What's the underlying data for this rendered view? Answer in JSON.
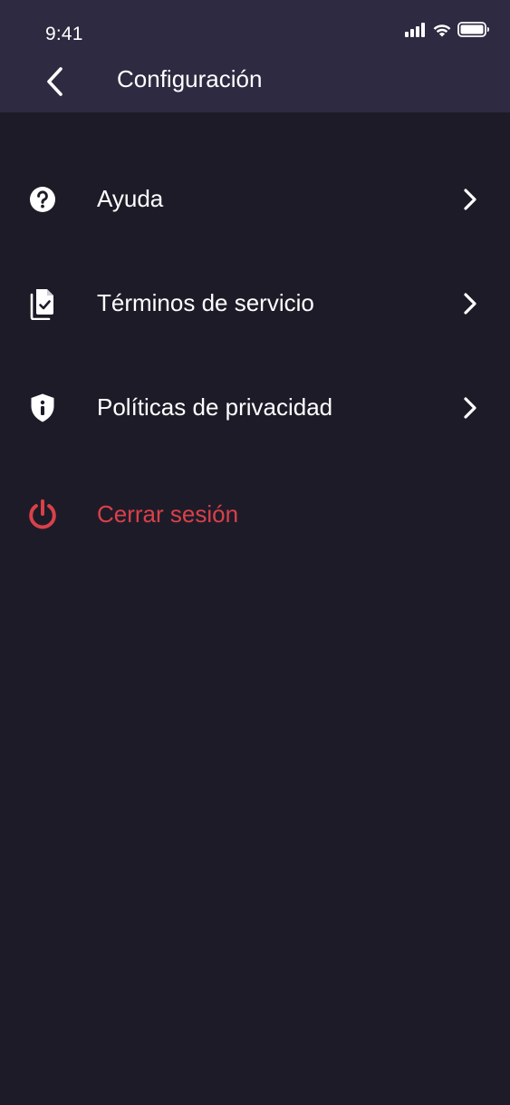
{
  "status_bar": {
    "time": "9:41"
  },
  "header": {
    "title": "Configuración"
  },
  "menu": {
    "items": [
      {
        "label": "Ayuda",
        "icon": "help-circle-icon"
      },
      {
        "label": "Términos de servicio",
        "icon": "document-check-icon"
      },
      {
        "label": "Políticas de privacidad",
        "icon": "shield-info-icon"
      }
    ],
    "logout": {
      "label": "Cerrar sesión",
      "icon": "power-icon"
    }
  },
  "colors": {
    "header_bg": "#2e2a41",
    "page_bg": "#1e1b28",
    "text": "#ffffff",
    "danger": "#d9414a"
  }
}
